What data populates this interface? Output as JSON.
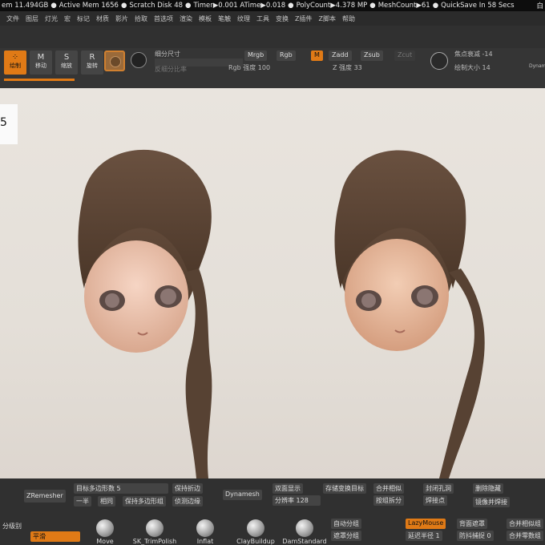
{
  "status": {
    "mem": "em 11.494GB",
    "active_mem": "Active Mem 1656",
    "scratch": "Scratch Disk 48",
    "timer": "Timer▶0.001 ATime▶0.018",
    "polycount": "PolyCount▶4.378 MP",
    "meshcount": "MeshCount▶61",
    "quicksave": "QuickSave In 58 Secs",
    "right": "白"
  },
  "menu": [
    "文件",
    "图层",
    "灯光",
    "宏",
    "标记",
    "材质",
    "影片",
    "拾取",
    "首选项",
    "渲染",
    "模板",
    "笔触",
    "纹理",
    "工具",
    "变换",
    "Z插件",
    "Z脚本",
    "帮助"
  ],
  "toolbar": {
    "draw": "绘制",
    "move": "移动",
    "scale": "缩放",
    "rotate": "旋转",
    "subdiv_size": "细分尺寸",
    "subdiv_ratio": "反细分比率",
    "mrgb": "Mrgb",
    "rgb": "Rgb",
    "m": "M",
    "zadd": "Zadd",
    "zsub": "Zsub",
    "zcut": "Zcut",
    "rgb_intensity": "Rgb 强度 100",
    "z_intensity": "Z 强度 33",
    "focal_shift": "焦点衰减 -14",
    "draw_size": "绘制大小 14",
    "dynamic": "Dynam"
  },
  "canvas_label": "5",
  "bottom": {
    "zremesher": "ZRemesher",
    "target_poly": "目标多边形数 5",
    "half": "一半",
    "same": "相同",
    "keep_poly": "保持多边形组",
    "keep_crease": "保持折边",
    "detect_edge": "侦测边缘",
    "dynamesh": "Dynamesh",
    "double": "双面显示",
    "resolution": "分辨率 128",
    "store_morph": "存储变换目标",
    "merge_similar": "合并相似",
    "split_by_group": "按组拆分",
    "close_holes": "封闭孔洞",
    "weld_points": "焊接点",
    "delete_hidden": "删除隐藏",
    "mirror_weld": "镜像并焊接",
    "auto_group": "自动分组",
    "mask_group": "遮罩分组",
    "lazymouse": "LazyMouse",
    "back_mask": "背面遮罩",
    "merge_similar2": "合并相似组",
    "lazy_radius": "延迟半径 1",
    "anti_jitter": "防抖捕捉 0",
    "merge_zero": "合并零数组",
    "subdiv_level": "分级别",
    "smooth": "平滑"
  },
  "brushes": [
    "Move",
    "SK_TrimPolish",
    "Inflat",
    "ClayBuildup",
    "DamStandard"
  ]
}
